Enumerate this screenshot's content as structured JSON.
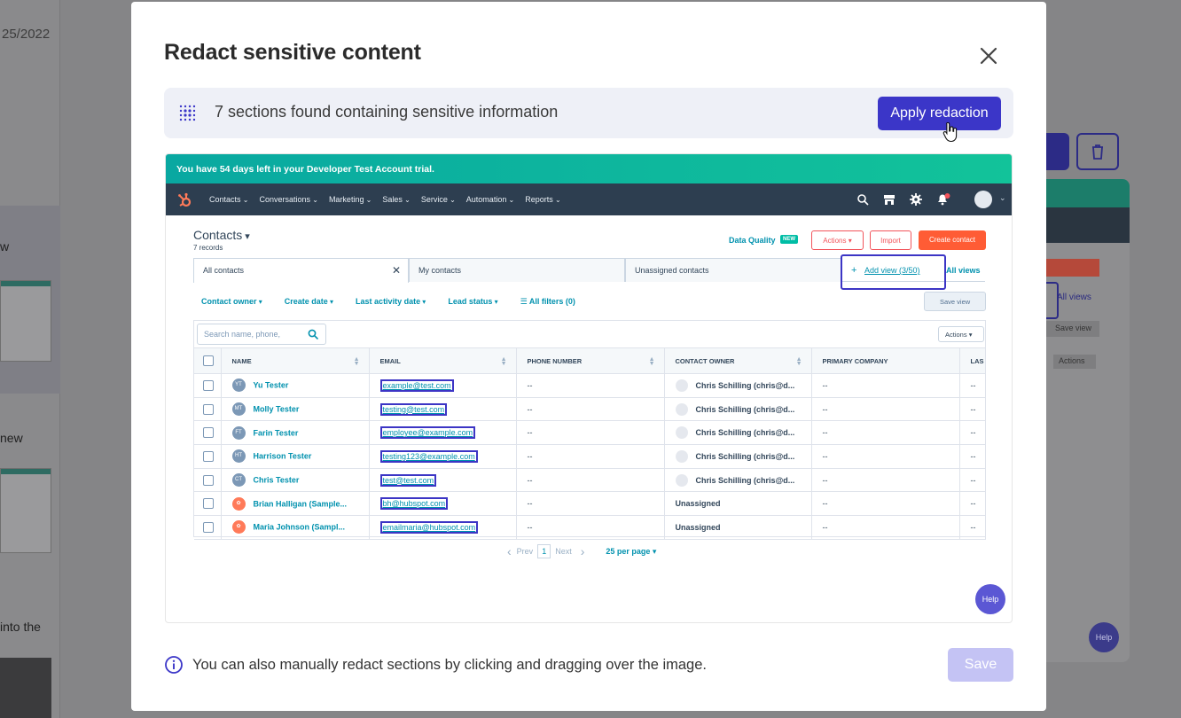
{
  "background": {
    "date_fragment": "25/2022",
    "left_words": [
      "w",
      "new",
      "into the"
    ],
    "right_all_views": "All views",
    "right_save_view": "Save view",
    "right_actions": "Actions",
    "right_help": "Help"
  },
  "modal": {
    "title": "Redact sensitive content",
    "banner_message": "7 sections found containing sensitive information",
    "apply_label": "Apply redaction",
    "footer_message": "You can also manually redact sections by clicking and dragging over the image.",
    "save_label": "Save"
  },
  "preview": {
    "trial_banner": "You have 54 days left in your Developer Test Account trial.",
    "nav_items": [
      "Contacts",
      "Conversations",
      "Marketing",
      "Sales",
      "Service",
      "Automation",
      "Reports"
    ],
    "contacts_title": "Contacts",
    "records": "7 records",
    "data_quality": "Data Quality",
    "new_badge": "NEW",
    "actions": "Actions",
    "import": "Import",
    "create_contact": "Create contact",
    "tabs": [
      "All contacts",
      "My contacts",
      "Unassigned contacts"
    ],
    "add_view": "Add view (3/50)",
    "all_views": "All views",
    "filters": [
      "Contact owner",
      "Create date",
      "Last activity date",
      "Lead status",
      "All filters (0)"
    ],
    "save_view": "Save view",
    "search_placeholder": "Search name, phone,",
    "table_actions": "Actions",
    "columns": [
      "NAME",
      "EMAIL",
      "PHONE NUMBER",
      "CONTACT OWNER",
      "PRIMARY COMPANY",
      "LAS"
    ],
    "rows": [
      {
        "initials": "YT",
        "name": "Yu Tester",
        "email": "example@test.com",
        "phone": "--",
        "owner": "Chris Schilling (chris@d...",
        "company": "--",
        "last": "--"
      },
      {
        "initials": "MT",
        "name": "Molly Tester",
        "email": "testing@test.com",
        "phone": "--",
        "owner": "Chris Schilling (chris@d...",
        "company": "--",
        "last": "--"
      },
      {
        "initials": "FT",
        "name": "Farin Tester",
        "email": "employee@example.com",
        "phone": "--",
        "owner": "Chris Schilling (chris@d...",
        "company": "--",
        "last": "--"
      },
      {
        "initials": "HT",
        "name": "Harrison Tester",
        "email": "testing123@example.com",
        "phone": "--",
        "owner": "Chris Schilling (chris@d...",
        "company": "--",
        "last": "--"
      },
      {
        "initials": "CT",
        "name": "Chris Tester",
        "email": "test@test.com",
        "phone": "--",
        "owner": "Chris Schilling (chris@d...",
        "company": "--",
        "last": "--"
      },
      {
        "initials": "",
        "name": "Brian Halligan (Sample...",
        "email": "bh@hubspot.com",
        "phone": "--",
        "owner": "Unassigned",
        "company": "--",
        "last": "--"
      },
      {
        "initials": "",
        "name": "Maria Johnson (Sampl...",
        "email": "emailmaria@hubspot.com",
        "phone": "--",
        "owner": "Unassigned",
        "company": "--",
        "last": "--"
      }
    ],
    "pager_prev": "Prev",
    "pager_page": "1",
    "pager_next": "Next",
    "per_page": "25 per page",
    "help": "Help"
  }
}
